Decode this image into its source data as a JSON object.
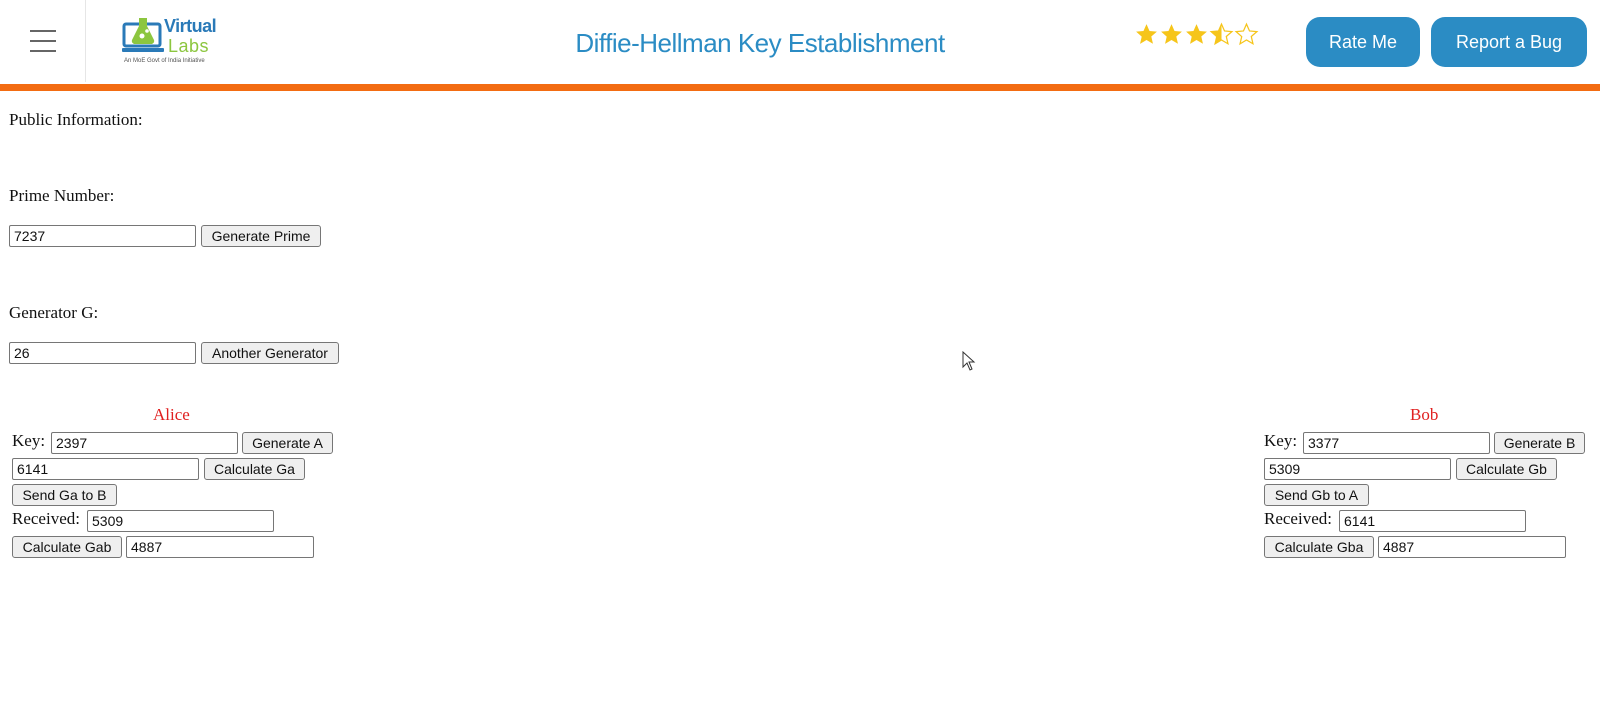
{
  "header": {
    "logo": {
      "line1": "Virtual",
      "line2": "Labs",
      "tagline": "An MoE Govt of India Initiative"
    },
    "title": "Diffie-Hellman Key Establishment",
    "rating": 3.5,
    "rate_label": "Rate Me",
    "bug_label": "Report a Bug",
    "accent_color": "#f36c12",
    "brand_color": "#2b8cc4",
    "star_color": "#f6c51a"
  },
  "public": {
    "heading": "Public Information:",
    "prime_label": "Prime Number:",
    "prime_value": "7237",
    "prime_button": "Generate Prime",
    "gen_label": "Generator G:",
    "gen_value": "26",
    "gen_button": "Another Generator"
  },
  "alice": {
    "name": "Alice",
    "key_label": "Key:",
    "key_value": "2397",
    "gen_button": "Generate A",
    "ga_value": "6141",
    "calc_button": "Calculate Ga",
    "send_button": "Send Ga to B",
    "received_label": "Received:",
    "received_value": "5309",
    "shared_button": "Calculate Gab",
    "shared_value": "4887"
  },
  "bob": {
    "name": "Bob",
    "key_label": "Key:",
    "key_value": "3377",
    "gen_button": "Generate B",
    "gb_value": "5309",
    "calc_button": "Calculate Gb",
    "send_button": "Send Gb to A",
    "received_label": "Received:",
    "received_value": "6141",
    "shared_button": "Calculate Gba",
    "shared_value": "4887"
  }
}
